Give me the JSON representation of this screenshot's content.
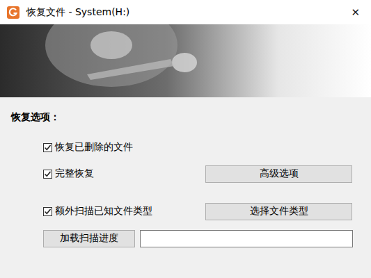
{
  "window": {
    "title": "恢复文件 - System(H:)",
    "close": "✕"
  },
  "section": {
    "label": "恢复选项："
  },
  "options": [
    {
      "label": "恢复已删除的文件",
      "checked": true,
      "button": ""
    },
    {
      "label": "完整恢复",
      "checked": true,
      "button": "高级选项"
    },
    {
      "label": "额外扫描已知文件类型",
      "checked": true,
      "button": "选择文件类型"
    }
  ],
  "scan_progress": {
    "button": "加载扫描进度",
    "value": ""
  }
}
